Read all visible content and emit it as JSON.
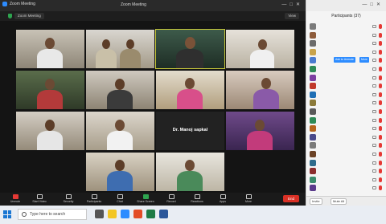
{
  "window": {
    "app_title": "Zoom Meeting",
    "meeting_title": "Zoom Meeting"
  },
  "meeting_bar": {
    "chip_label": "Zoom Meeting",
    "view_label": "View"
  },
  "tiles": [
    {
      "name": "",
      "has_video": true
    },
    {
      "name": "",
      "has_video": true
    },
    {
      "name": "",
      "has_video": true,
      "active": true
    },
    {
      "name": "",
      "has_video": true
    },
    {
      "name": "",
      "has_video": true
    },
    {
      "name": "",
      "has_video": true
    },
    {
      "name": "",
      "has_video": true
    },
    {
      "name": "",
      "has_video": true
    },
    {
      "name": "",
      "has_video": true
    },
    {
      "name": "",
      "has_video": true
    },
    {
      "name": "Dr. Manoj sapkal",
      "has_video": false
    },
    {
      "name": "",
      "has_video": true
    },
    {
      "name": "",
      "has_video": true
    },
    {
      "name": "",
      "has_video": true
    }
  ],
  "controls": {
    "unmute": "Unmute",
    "stop_video": "Start Video",
    "security": "Security",
    "participants": "Participants",
    "chat": "Chat",
    "share": "Share Screen",
    "record": "Record",
    "reactions": "Reactions",
    "apps": "Apps",
    "more": "More",
    "end": "End"
  },
  "panel": {
    "title": "Participants (37)",
    "admit_label": "Ask to Unmute",
    "more_label": "More",
    "participants": [
      {
        "name": "",
        "color": "#7a7a7a"
      },
      {
        "name": "",
        "color": "#8d5b3a"
      },
      {
        "name": "",
        "color": "#6b6b6b"
      },
      {
        "name": "",
        "color": "#c9a34b"
      },
      {
        "name": "",
        "color": "#4a7bd0"
      },
      {
        "name": "",
        "color": "#2e8b57"
      },
      {
        "name": "",
        "color": "#7b3fa0"
      },
      {
        "name": "",
        "color": "#c0392b"
      },
      {
        "name": "",
        "color": "#1f6fb5"
      },
      {
        "name": "",
        "color": "#8b7a3a"
      },
      {
        "name": "",
        "color": "#5a5a5a"
      },
      {
        "name": "",
        "color": "#2e8b57"
      },
      {
        "name": "",
        "color": "#b5651d"
      },
      {
        "name": "",
        "color": "#4a4a8a"
      },
      {
        "name": "",
        "color": "#7a7a7a"
      },
      {
        "name": "",
        "color": "#6b4226"
      },
      {
        "name": "",
        "color": "#2e6b8b"
      },
      {
        "name": "",
        "color": "#8b2e2e"
      },
      {
        "name": "",
        "color": "#3a8b6b"
      },
      {
        "name": "",
        "color": "#5a3a8b"
      }
    ],
    "invite_label": "Invite",
    "mute_all_label": "Mute All"
  },
  "taskbar": {
    "search_placeholder": "Type here to search",
    "tray_time": "",
    "tray_date": ""
  },
  "colors": {
    "accent": "#2d8cff",
    "end_red": "#d93025",
    "active_speaker": "#c9c93a"
  }
}
